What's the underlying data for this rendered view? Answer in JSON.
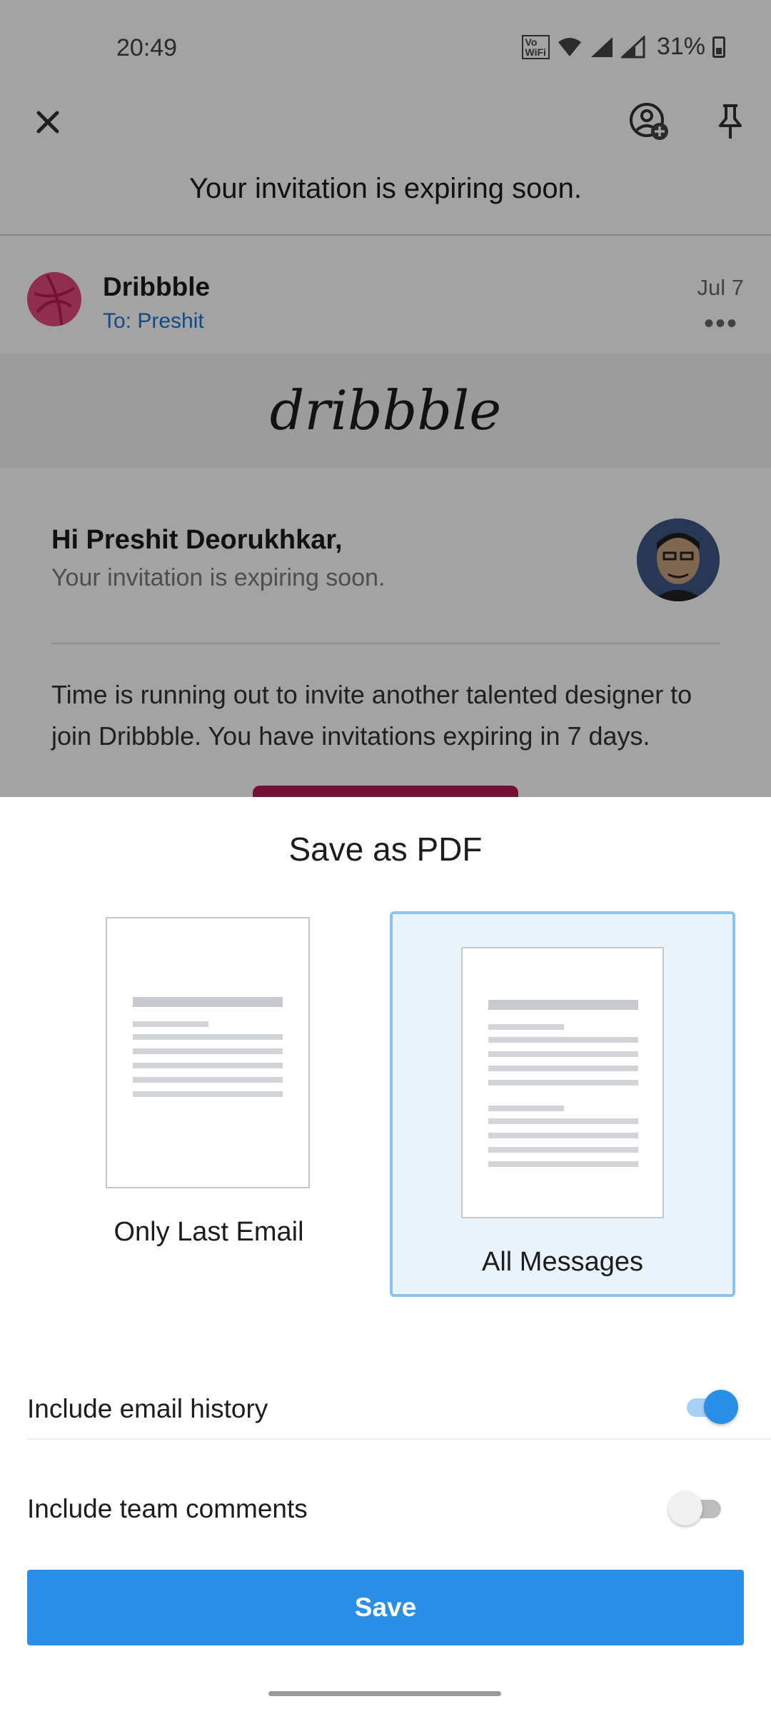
{
  "status_bar": {
    "time": "20:49",
    "network_label": "VoLTE WiFi",
    "battery": "31%"
  },
  "header": {
    "subject": "Your invitation is expiring soon."
  },
  "message": {
    "sender": "Dribbble",
    "to": "To: Preshit",
    "date": "Jul 7",
    "brand": "dribbble",
    "greeting": "Hi Preshit Deorukhkar,",
    "greeting_sub": "Your invitation is expiring soon.",
    "body": "Time is running out to invite another talented designer to join Dribbble. You have invitations expiring in 7 days."
  },
  "sheet": {
    "title": "Save as PDF",
    "options": [
      {
        "label": "Only Last Email",
        "selected": false
      },
      {
        "label": "All Messages",
        "selected": true
      }
    ],
    "toggles": [
      {
        "label": "Include email history",
        "on": true
      },
      {
        "label": "Include team comments",
        "on": false
      }
    ],
    "save_label": "Save"
  },
  "colors": {
    "accent": "#2a8fe6",
    "selected_bg": "#e9f3fc",
    "selected_border": "#8cc2ef",
    "link": "#1f74c8",
    "brand_pink": "#e0497b"
  },
  "icons": [
    "close-icon",
    "assign-user-icon",
    "pin-icon",
    "wifi-icon",
    "signal-icon",
    "battery-icon",
    "more-icon"
  ]
}
